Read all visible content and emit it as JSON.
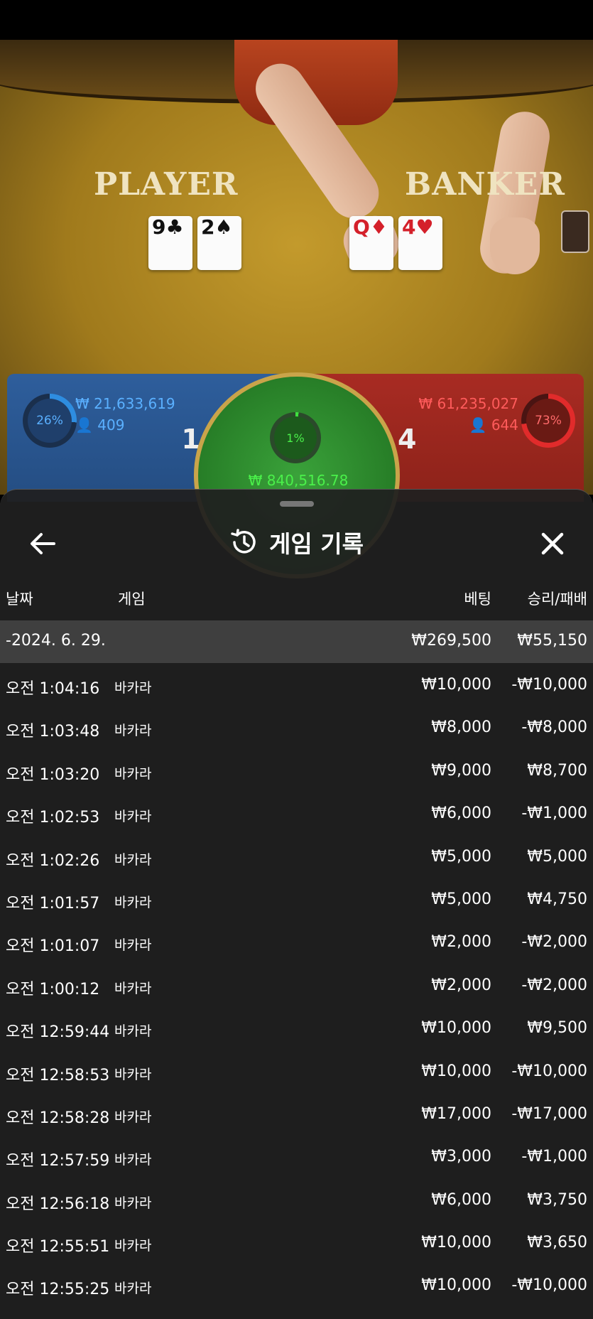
{
  "table": {
    "player_label": "PLAYER",
    "banker_label": "BANKER",
    "player_cards": [
      {
        "rank": "9",
        "suit": "♣",
        "color": "black"
      },
      {
        "rank": "2",
        "suit": "♠",
        "color": "black"
      }
    ],
    "banker_cards": [
      {
        "rank": "Q",
        "suit": "♦",
        "color": "red"
      },
      {
        "rank": "4",
        "suit": "♥",
        "color": "red"
      }
    ]
  },
  "bets": {
    "player": {
      "percent": "26%",
      "percent_value": 26,
      "amount": "₩ 21,633,619",
      "count": "409",
      "score": "1"
    },
    "banker": {
      "percent": "73%",
      "percent_value": 73,
      "amount": "₩ 61,235,027",
      "count": "644",
      "score": "4"
    },
    "tie": {
      "percent": "1%",
      "percent_value": 1,
      "amount": "₩ 840,516.78"
    }
  },
  "sheet": {
    "title": "게임 기록",
    "headers": {
      "date": "날짜",
      "game": "게임",
      "bet": "베팅",
      "result": "승리/패배"
    },
    "summary": {
      "date": "-2024. 6. 29.",
      "bet": "₩269,500",
      "result": "₩55,150"
    },
    "rows": [
      {
        "date": "오전 1:04:16",
        "game": "바카라",
        "bet": "₩10,000",
        "result": "-₩10,000"
      },
      {
        "date": "오전 1:03:48",
        "game": "바카라",
        "bet": "₩8,000",
        "result": "-₩8,000"
      },
      {
        "date": "오전 1:03:20",
        "game": "바카라",
        "bet": "₩9,000",
        "result": "₩8,700"
      },
      {
        "date": "오전 1:02:53",
        "game": "바카라",
        "bet": "₩6,000",
        "result": "-₩1,000"
      },
      {
        "date": "오전 1:02:26",
        "game": "바카라",
        "bet": "₩5,000",
        "result": "₩5,000"
      },
      {
        "date": "오전 1:01:57",
        "game": "바카라",
        "bet": "₩5,000",
        "result": "₩4,750"
      },
      {
        "date": "오전 1:01:07",
        "game": "바카라",
        "bet": "₩2,000",
        "result": "-₩2,000"
      },
      {
        "date": "오전 1:00:12",
        "game": "바카라",
        "bet": "₩2,000",
        "result": "-₩2,000"
      },
      {
        "date": "오전 12:59:44",
        "game": "바카라",
        "bet": "₩10,000",
        "result": "₩9,500"
      },
      {
        "date": "오전 12:58:53",
        "game": "바카라",
        "bet": "₩10,000",
        "result": "-₩10,000"
      },
      {
        "date": "오전 12:58:28",
        "game": "바카라",
        "bet": "₩17,000",
        "result": "-₩17,000"
      },
      {
        "date": "오전 12:57:59",
        "game": "바카라",
        "bet": "₩3,000",
        "result": "-₩1,000"
      },
      {
        "date": "오전 12:56:18",
        "game": "바카라",
        "bet": "₩6,000",
        "result": "₩3,750"
      },
      {
        "date": "오전 12:55:51",
        "game": "바카라",
        "bet": "₩10,000",
        "result": "₩3,650"
      },
      {
        "date": "오전 12:55:25",
        "game": "바카라",
        "bet": "₩10,000",
        "result": "-₩10,000"
      }
    ]
  },
  "colors": {
    "player_blue": "#2e8de0",
    "banker_red": "#e12b2b",
    "tie_green": "#3ee03e",
    "sheet_bg": "#202020"
  }
}
